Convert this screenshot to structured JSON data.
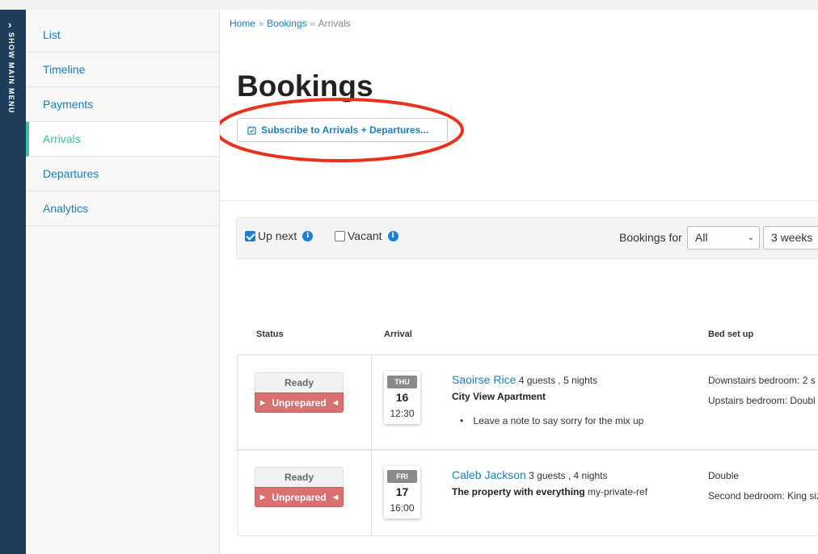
{
  "main_menu": {
    "label": "SHOW MAIN MENU"
  },
  "sidebar": {
    "items": [
      {
        "label": "List"
      },
      {
        "label": "Timeline"
      },
      {
        "label": "Payments"
      },
      {
        "label": "Arrivals"
      },
      {
        "label": "Departures"
      },
      {
        "label": "Analytics"
      }
    ],
    "active": "Arrivals"
  },
  "breadcrumb": {
    "items": [
      "Home",
      "Bookings",
      "Arrivals"
    ]
  },
  "page": {
    "title": "Bookings",
    "subscribe_label": "Subscribe to Arrivals + Departures..."
  },
  "filters": {
    "up_next": {
      "label": "Up next",
      "checked": true
    },
    "vacant": {
      "label": "Vacant",
      "checked": false
    },
    "bookings_for_label": "Bookings for",
    "scope_select": "All",
    "range_select": "3 weeks"
  },
  "table": {
    "headers": {
      "status": "Status",
      "arrival": "Arrival",
      "bed": "Bed set up"
    },
    "rows": [
      {
        "status_top": "Ready",
        "status_bottom": "Unprepared",
        "dow": "THU",
        "day": "16",
        "time": "12:30",
        "guest_name": "Saoirse Rice",
        "guest_meta": "4 guests , 5 nights",
        "property": "City View Apartment",
        "property_ref": "",
        "note": "Leave a note to say sorry for the mix up",
        "bed_lines": [
          "Downstairs bedroom: 2 s",
          "Upstairs bedroom: Doubl"
        ]
      },
      {
        "status_top": "Ready",
        "status_bottom": "Unprepared",
        "dow": "FRI",
        "day": "17",
        "time": "16:00",
        "guest_name": "Caleb Jackson",
        "guest_meta": "3 guests , 4 nights",
        "property": "The property with everything",
        "property_ref": "my-private-ref",
        "note": "",
        "bed_lines": [
          "Double",
          "Second bedroom: King siz"
        ]
      }
    ]
  },
  "colors": {
    "menu_strip": "#1e3d5a",
    "link": "#1a7fb8",
    "active_nav": "#3dbf9c",
    "unprepared": "#d9706f",
    "annotation": "#e8321e"
  },
  "icons": {
    "menu_chevron": "chevron-right-icon",
    "breadcrumb_separator": "double-chevron-right-icon",
    "subscribe": "calendar-check-icon",
    "info": "info-icon",
    "status_arrows": "triangle-icon"
  }
}
